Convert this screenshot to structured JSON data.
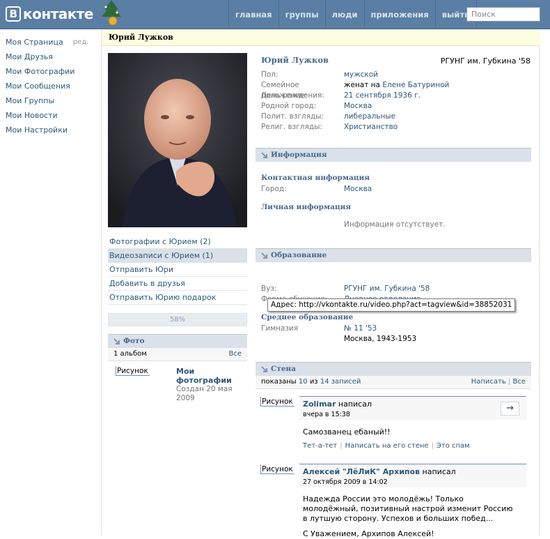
{
  "header": {
    "logo_text": "контакте",
    "logo_letter": "В",
    "nav": [
      "главная",
      "группы",
      "люди",
      "приложения",
      "выйти"
    ],
    "search_placeholder": "Поиск"
  },
  "sidebar": {
    "items": [
      {
        "label": "Моя Страница",
        "edit": "ред."
      },
      {
        "label": "Мои Друзья"
      },
      {
        "label": "Мои Фотографии"
      },
      {
        "label": "Мои Сообщения"
      },
      {
        "label": "Мои Группы"
      },
      {
        "label": "Мои Новости"
      },
      {
        "label": "Мои Настройки"
      }
    ]
  },
  "profile": {
    "page_title": "Юрий Лужков",
    "name": "Юрий Лужков",
    "university_short": "РГУНГ им. Губкина '58",
    "fields": [
      {
        "key": "Пол:",
        "value": "мужской"
      },
      {
        "key": "Семейное положение:",
        "value_prefix": "женат на ",
        "value": "Елене Батуриной"
      },
      {
        "key": "День рождения:",
        "value": "21 сентября 1936 г."
      },
      {
        "key": "Родной город:",
        "value": "Москва"
      },
      {
        "key": "Полит. взгляды:",
        "value": "либеральные"
      },
      {
        "key": "Религ. взгляды:",
        "value": "Христианство"
      }
    ]
  },
  "actions": [
    "Фотографии с Юрием (2)",
    "Видеозаписи с Юрием (1)",
    "Отправить Юри",
    "Добавить в друзья",
    "Отправить Юрию подарок"
  ],
  "rating": {
    "text": "58%",
    "percent": 58
  },
  "info_section": {
    "title": "Информация",
    "contact_heading": "Контактная информация",
    "city_key": "Город:",
    "city_value": "Москва",
    "personal_heading": "Личная информация",
    "no_info": "Информация отсутствует."
  },
  "education": {
    "title": "Образование",
    "vuz_key": "Вуз:",
    "vuz_value": "РГУНГ им. Губкина '58",
    "form_key": "Форма обучения:",
    "form_value": "Дневное отделение",
    "secondary_heading": "Среднее образование",
    "school_key": "Гимназия",
    "school_value": "№ 11 '53",
    "school_place": "Москва, 1943-1953"
  },
  "photos": {
    "title": "Фото",
    "count": "1 альбом",
    "all": "Все",
    "image_alt": "Рисунок",
    "album_title": "Мои фотографии",
    "album_date": "Создан 20 мая 2009"
  },
  "wall": {
    "title": "Стена",
    "shown_prefix": "показаны",
    "shown": "10",
    "of": "из",
    "total": "14 записей",
    "write": "Написать",
    "all": "Все",
    "posts": [
      {
        "image_alt": "Рисунок",
        "author": "Zolimar",
        "wrote": "написал",
        "date": "вчера в 15:38",
        "text": "Самозванец ебаный!!",
        "links": [
          "Тет-а-тет",
          "Написать на его стене",
          "Это спам"
        ]
      },
      {
        "image_alt": "Рисунок",
        "author": "Алексей \"ЛёЛиК\" Архипов",
        "wrote": "написал",
        "date": "27 октября 2009 в 14:02",
        "text": "Надежда России это молодёжь! Только молодёжный, позитивный настрой изменит Россию в лутшую сторону. Успехов и больших побед...",
        "text2": "С Уважением, Архипов Алексей!"
      }
    ]
  },
  "tooltip": "Адрес: http://vkontakte.ru/video.php?act=tagview&id=38852031"
}
